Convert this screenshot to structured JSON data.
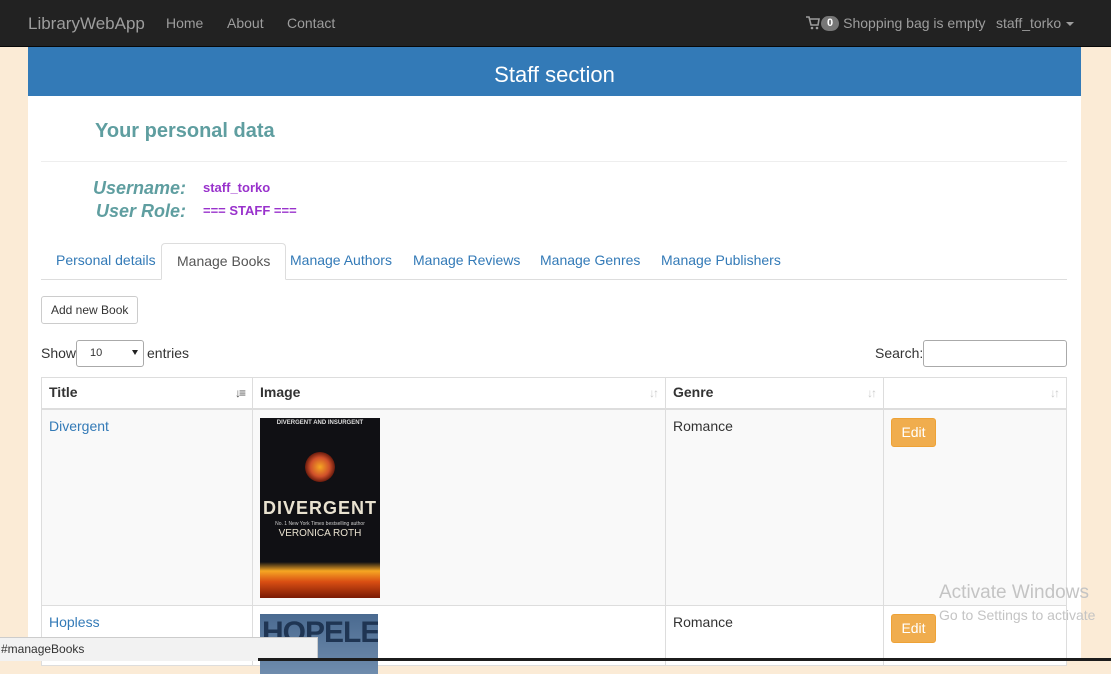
{
  "navbar": {
    "brand": "LibraryWebApp",
    "links": [
      "Home",
      "About",
      "Contact"
    ],
    "cart_count": "0",
    "cart_text": "Shopping bag is empty",
    "cart_icon": "shopping-cart-icon",
    "user": "staff_torko"
  },
  "banner": "Staff section",
  "personal": {
    "title": "Your personal data",
    "username_label": "Username:",
    "username": "staff_torko",
    "role_label": "User Role:",
    "role": "=== STAFF ==="
  },
  "tabs": [
    {
      "label": "Personal details",
      "active": false
    },
    {
      "label": "Manage Books",
      "active": true
    },
    {
      "label": "Manage Authors",
      "active": false
    },
    {
      "label": "Manage Reviews",
      "active": false
    },
    {
      "label": "Manage Genres",
      "active": false
    },
    {
      "label": "Manage Publishers",
      "active": false
    }
  ],
  "add_button": "Add new Book",
  "length": {
    "show": "Show",
    "value": "10",
    "entries": "entries"
  },
  "search": {
    "label": "Search:",
    "value": ""
  },
  "table": {
    "columns": [
      "Title",
      "Image",
      "Genre",
      ""
    ],
    "rows": [
      {
        "title": "Divergent",
        "genre": "Romance",
        "action": "Edit",
        "cover": {
          "top": "DIVERGENT AND INSURGENT",
          "title": "DIVERGENT",
          "sub": "No. 1 New York Times bestselling author",
          "author": "VERONICA ROTH"
        }
      },
      {
        "title": "Hopless",
        "genre": "Romance",
        "action": "Edit",
        "cover": {
          "title": "HOPELESS"
        }
      }
    ]
  },
  "watermark": {
    "line1": "Activate Windows",
    "line2": "Go to Settings to activate"
  },
  "status_url": "#manageBooks",
  "colors": {
    "navbar": "#222222",
    "banner": "#337ab7",
    "heading": "#5f9ea0",
    "value": "#9932cc",
    "link": "#337ab7",
    "edit_button": "#f0ad4e",
    "page_bg": "#fbebd6"
  }
}
